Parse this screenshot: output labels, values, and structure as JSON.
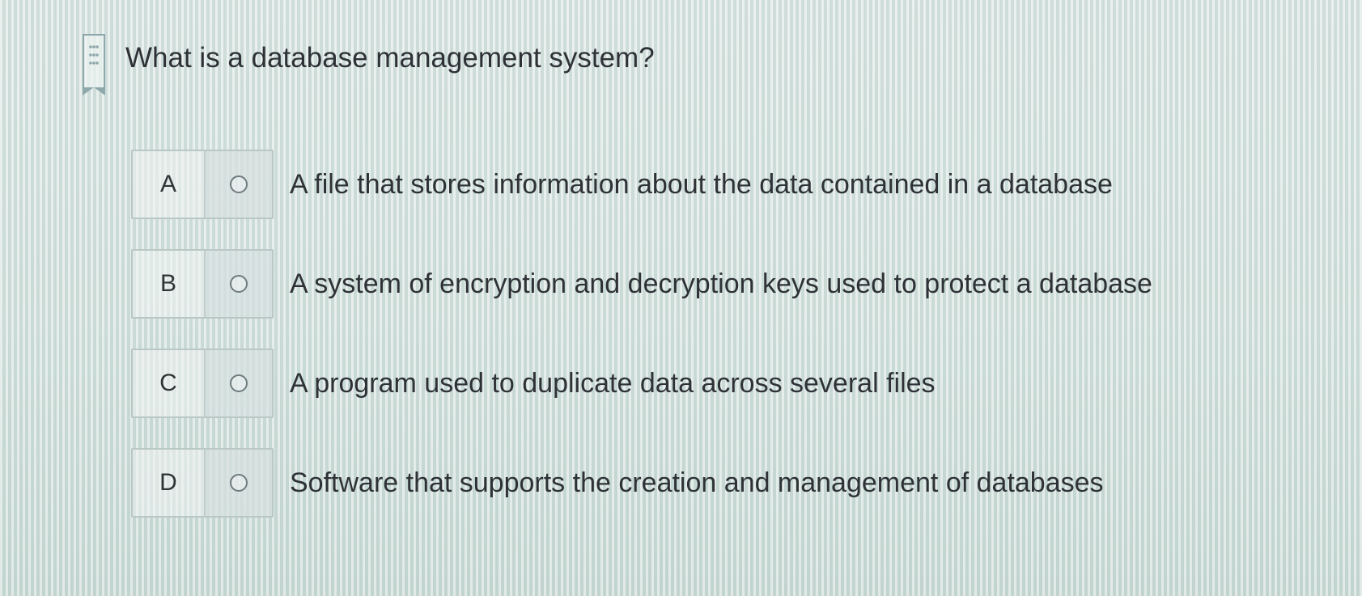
{
  "question": {
    "text": "What is a database management system?",
    "bookmark_icon": "bookmark-icon"
  },
  "options": [
    {
      "letter": "A",
      "text": "A file that stores information about the data contained in a database",
      "selected": false
    },
    {
      "letter": "B",
      "text": "A system of encryption and decryption keys used to protect a database",
      "selected": false
    },
    {
      "letter": "C",
      "text": "A program used to duplicate data across several files",
      "selected": false
    },
    {
      "letter": "D",
      "text": "Software that supports the creation and management of databases",
      "selected": false
    }
  ]
}
